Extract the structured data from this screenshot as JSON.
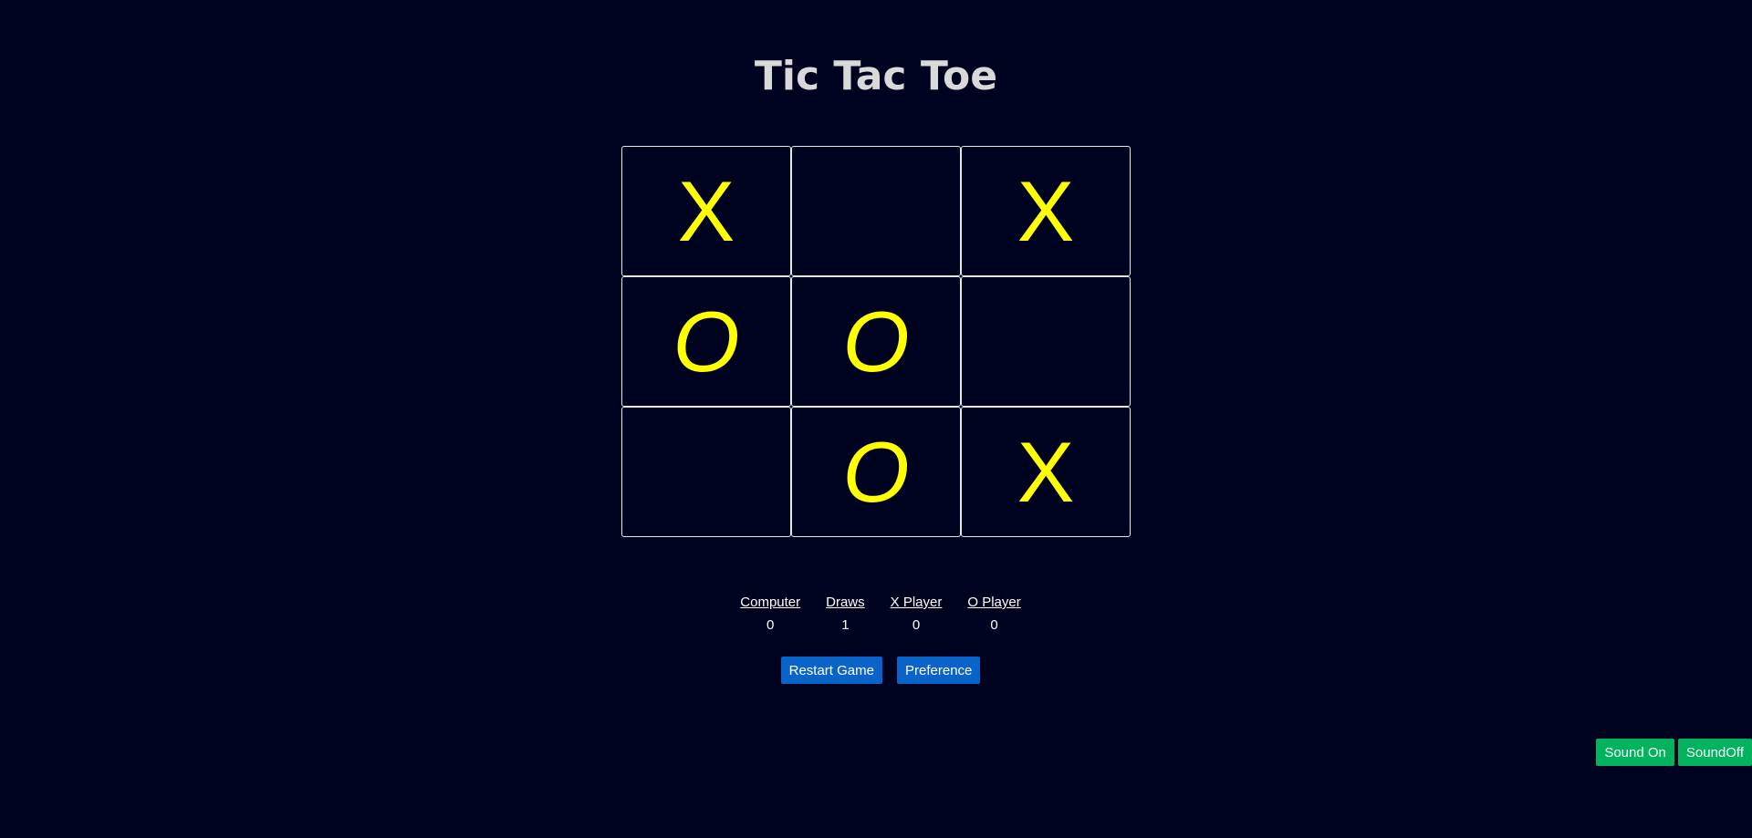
{
  "title": "Tic Tac Toe",
  "board": {
    "cells": [
      "X",
      "",
      "X",
      "O",
      "O",
      "",
      "",
      "O",
      "X"
    ]
  },
  "scores": [
    {
      "label": "Computer",
      "value": "0"
    },
    {
      "label": "Draws",
      "value": "1"
    },
    {
      "label": "X Player",
      "value": "0"
    },
    {
      "label": "O Player",
      "value": "0"
    }
  ],
  "controls": {
    "restart_label": "Restart Game",
    "preference_label": "Preference"
  },
  "sound": {
    "on_label": "Sound On",
    "off_label": "SoundOff"
  },
  "colors": {
    "background": "#00031f",
    "mark": "#ffff00",
    "primary_button": "#0a63c9",
    "sound_button": "#00b35c"
  }
}
